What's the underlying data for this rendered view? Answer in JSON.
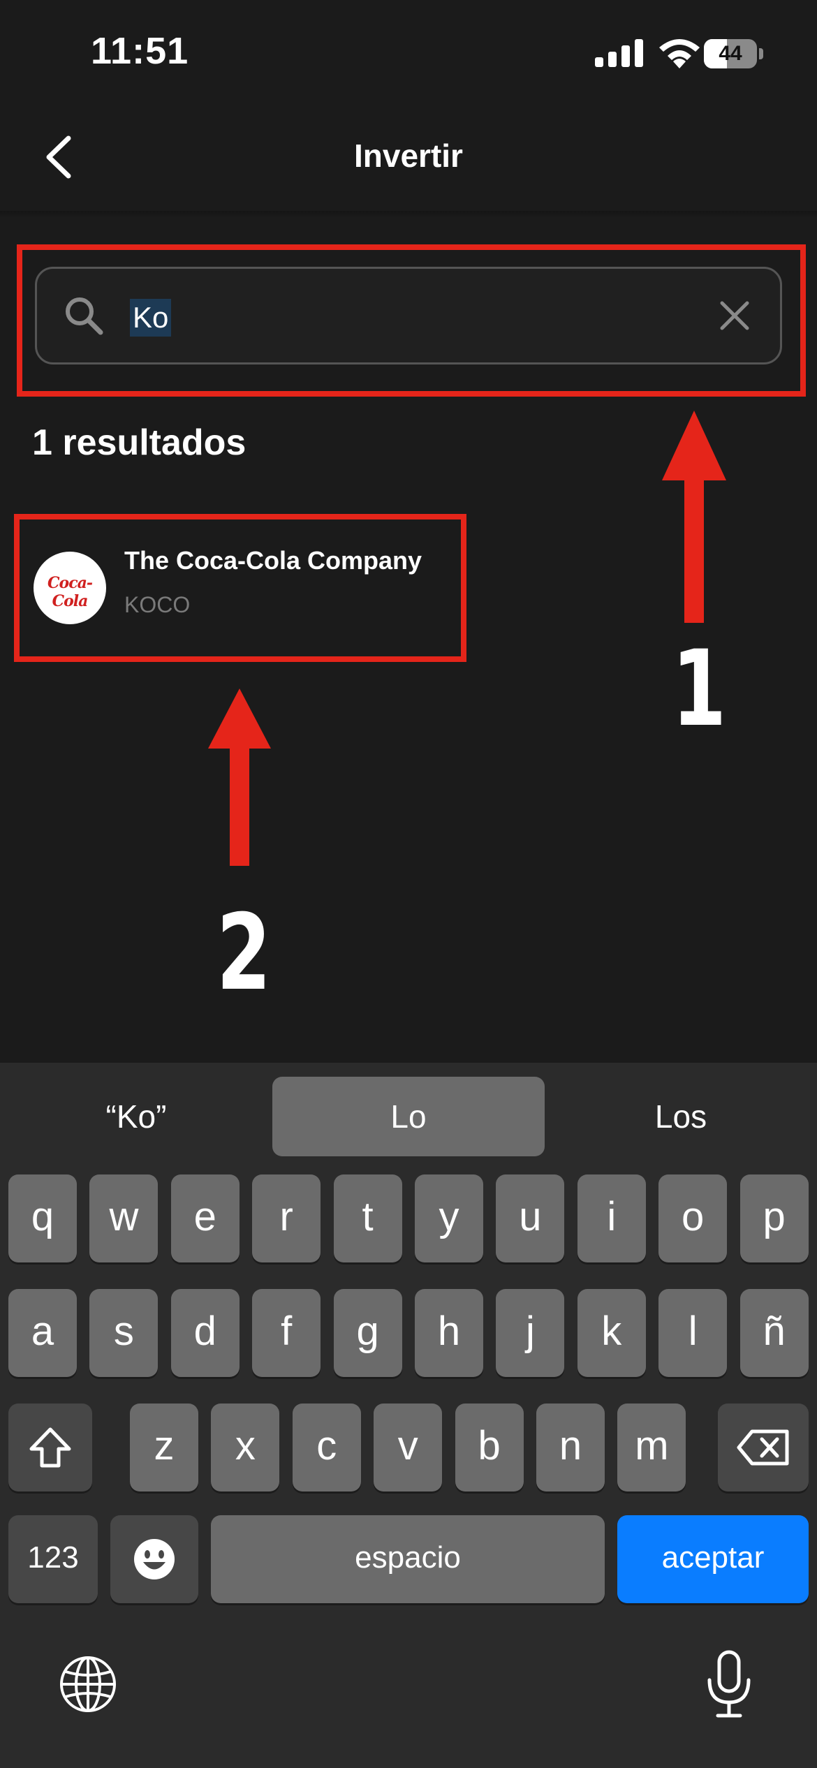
{
  "status_bar": {
    "time": "11:51",
    "battery": "44",
    "battery_level": 0.44
  },
  "nav": {
    "title": "Invertir",
    "back_icon": "chevron-left-icon"
  },
  "search": {
    "value": "Ko",
    "search_icon": "search-icon",
    "clear_icon": "close-icon"
  },
  "results": {
    "count_label": "1 resultados",
    "items": [
      {
        "name": "The Coca-Cola Company",
        "ticker": "KOCO",
        "logo_text": "Coca-Cola"
      }
    ]
  },
  "annotations": {
    "label_1": "1",
    "label_2": "2",
    "color": "#e5251a"
  },
  "keyboard": {
    "suggestions": [
      "“Ko”",
      "Lo",
      "Los"
    ],
    "row1": [
      "q",
      "w",
      "e",
      "r",
      "t",
      "y",
      "u",
      "i",
      "o",
      "p"
    ],
    "row2": [
      "a",
      "s",
      "d",
      "f",
      "g",
      "h",
      "j",
      "k",
      "l",
      "ñ"
    ],
    "row3": [
      "z",
      "x",
      "c",
      "v",
      "b",
      "n",
      "m"
    ],
    "numbers_label": "123",
    "space_label": "espacio",
    "accept_label": "aceptar",
    "accent_color": "#0a7dff"
  }
}
